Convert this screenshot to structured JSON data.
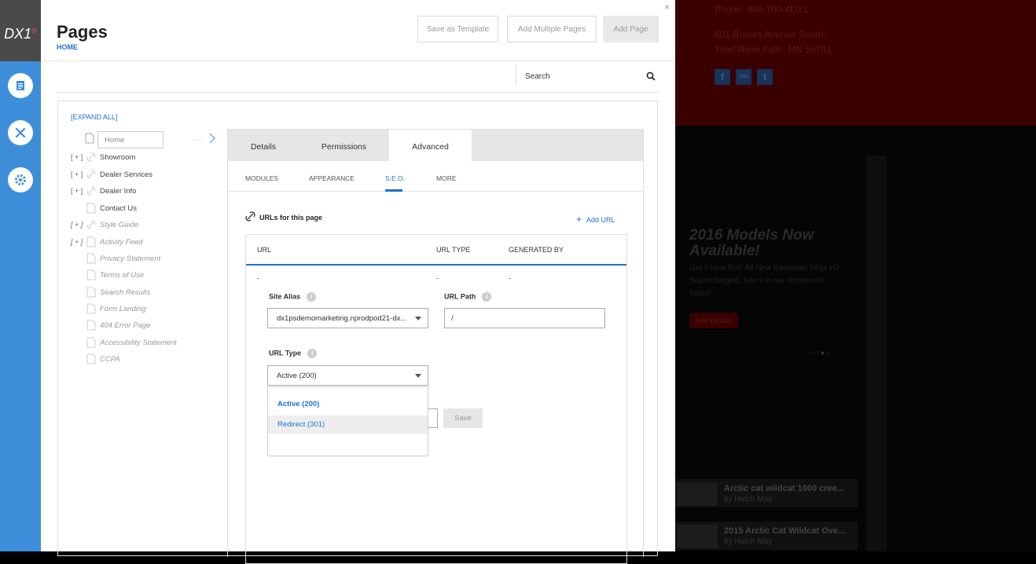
{
  "brand": {
    "logo": "DX1",
    "mark": "®"
  },
  "rail": {
    "icons": [
      "pages-icon",
      "tools-icon",
      "settings-icon"
    ]
  },
  "header": {
    "title": "Pages",
    "breadcrumb": "HOME",
    "buttons": {
      "save_template": "Save as Template",
      "add_multiple": "Add Multiple Pages",
      "add_page": "Add Page"
    },
    "close": "×"
  },
  "search": {
    "label": "Search"
  },
  "tree": {
    "expand_all": "[EXPAND ALL]",
    "home_input": "Home",
    "more": "···",
    "items": [
      {
        "label": "Showroom",
        "expandable": true,
        "icon": "link-icon",
        "italic": false
      },
      {
        "label": "Dealer Services",
        "expandable": true,
        "icon": "link-icon",
        "italic": false
      },
      {
        "label": "Dealer Info",
        "expandable": true,
        "icon": "link-icon",
        "italic": false
      },
      {
        "label": "Contact Us",
        "expandable": false,
        "icon": "page-icon",
        "italic": false
      },
      {
        "label": "Style Guide",
        "expandable": true,
        "icon": "link-icon",
        "italic": true
      },
      {
        "label": "Activity Feed",
        "expandable": true,
        "icon": "page-icon",
        "italic": true
      },
      {
        "label": "Privacy Statement",
        "expandable": false,
        "icon": "page-icon",
        "italic": true
      },
      {
        "label": "Terms of Use",
        "expandable": false,
        "icon": "page-icon",
        "italic": true
      },
      {
        "label": "Search Results",
        "expandable": false,
        "icon": "page-icon",
        "italic": true
      },
      {
        "label": "Form Landing",
        "expandable": false,
        "icon": "page-icon",
        "italic": true
      },
      {
        "label": "404 Error Page",
        "expandable": false,
        "icon": "page-icon",
        "italic": true
      },
      {
        "label": "Accessibility Statement",
        "expandable": false,
        "icon": "page-icon",
        "italic": true
      },
      {
        "label": "CCPA",
        "expandable": false,
        "icon": "page-icon",
        "italic": true
      }
    ],
    "plus": "[ + ]"
  },
  "tabs": {
    "details": "Details",
    "permissions": "Permissions",
    "advanced": "Advanced"
  },
  "subtabs": {
    "modules": "MODULES",
    "appearance": "APPEARANCE",
    "seo": "S.E.O.",
    "more": "MORE"
  },
  "urls": {
    "title": "URLs for this page",
    "add": "Add URL",
    "columns": {
      "url": "URL",
      "type": "URL TYPE",
      "generated": "GENERATED BY"
    },
    "row": {
      "url": "-",
      "type": "-",
      "generated": "-"
    }
  },
  "form": {
    "site_alias_label": "Site Alias",
    "site_alias_value": "dx1psdemomarketing.nprodpod21-dx...",
    "url_path_label": "URL Path",
    "url_path_value": "/",
    "url_type_label": "URL Type",
    "url_type_value": "Active (200)",
    "url_type_options": [
      "Active (200)",
      "Redirect (301)"
    ],
    "save": "Save",
    "info": "i"
  },
  "site": {
    "phone": "Phone: 800-700-4DX1",
    "address1": "601 Brooks Avenue South,",
    "address2": "Thief River Falls, MN 56701",
    "social": [
      "f",
      "You",
      "t"
    ],
    "hero_title1": "2016 Models Now",
    "hero_title2": "Available!",
    "hero_text": "Get it here first! All New Kawasaki Ninja H2 Supercharged. See it in our showroom today!",
    "hero_button": "See Details",
    "carousel_dots": "○○●○",
    "news": [
      {
        "title": "Arctic cat wildcat 1000 cree...",
        "sub": "by Hutch May"
      },
      {
        "title": "2015 Arctic Cat Wildcat Ove...",
        "sub": "by Hutch May"
      }
    ]
  }
}
